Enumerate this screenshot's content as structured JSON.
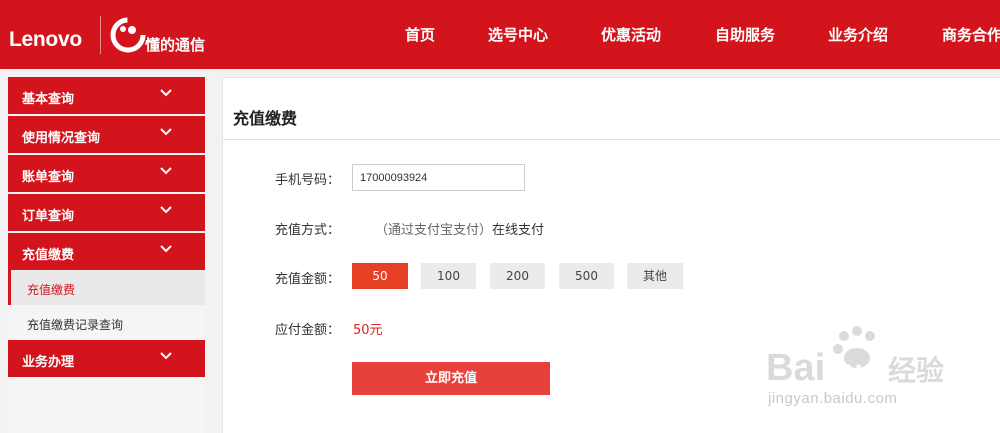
{
  "header": {
    "logo": "Lenovo",
    "brand": "懂的通信",
    "nav": [
      "首页",
      "选号中心",
      "优惠活动",
      "自助服务",
      "业务介绍",
      "商务合作"
    ]
  },
  "sidebar": {
    "items": [
      {
        "label": "基本查询"
      },
      {
        "label": "使用情况查询"
      },
      {
        "label": "账单查询"
      },
      {
        "label": "订单查询"
      },
      {
        "label": "充值缴费"
      },
      {
        "label": "业务办理"
      }
    ],
    "sub_items": [
      {
        "label": "充值缴费"
      },
      {
        "label": "充值缴费记录查询"
      }
    ]
  },
  "main": {
    "title": "充值缴费",
    "phone_label": "手机号码：",
    "phone_value": "17000093924",
    "method_label": "充值方式：",
    "method_text": "（通过支付宝支付）",
    "method_strong": "在线支付",
    "amount_label": "充值金额：",
    "amounts": [
      "50",
      "100",
      "200",
      "500",
      "其他"
    ],
    "selected_amount": "50",
    "pay_label": "应付金额：",
    "pay_value": "50元",
    "submit_label": "立即充值"
  },
  "watermark": {
    "url": "jingyan.baidu.com",
    "logo_text": "经验"
  },
  "colors": {
    "brand_red": "#d3141c",
    "accent_orange": "#e63f23",
    "price_red": "#e0201b"
  }
}
